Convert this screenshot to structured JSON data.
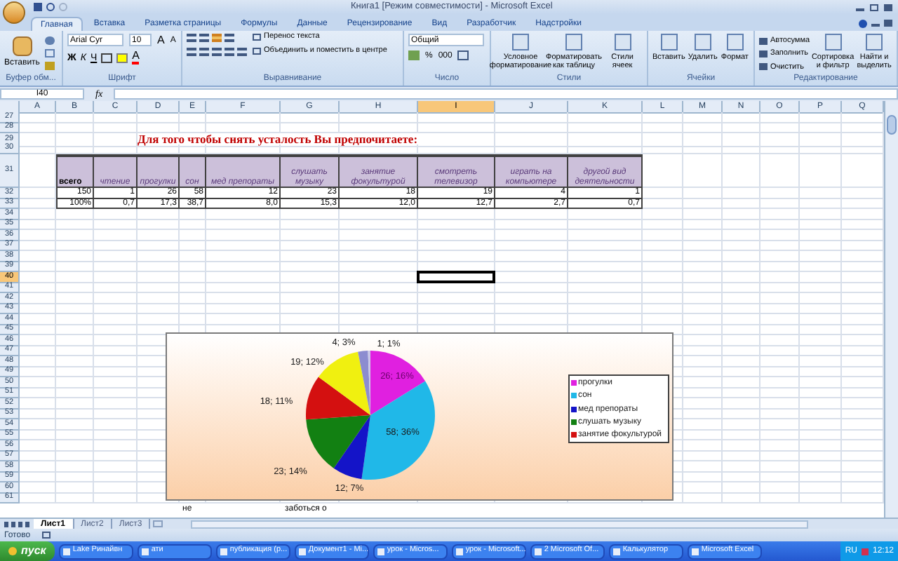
{
  "window": {
    "title": "Книга1  [Режим совместимости] - Microsoft Excel"
  },
  "tabs": [
    {
      "label": "Главная",
      "selected": true
    },
    {
      "label": "Вставка",
      "selected": false
    },
    {
      "label": "Разметка страницы",
      "selected": false
    },
    {
      "label": "Формулы",
      "selected": false
    },
    {
      "label": "Данные",
      "selected": false
    },
    {
      "label": "Рецензирование",
      "selected": false
    },
    {
      "label": "Вид",
      "selected": false
    },
    {
      "label": "Разработчик",
      "selected": false
    },
    {
      "label": "Надстройки",
      "selected": false
    }
  ],
  "ribbon": {
    "groups": [
      {
        "kind": "clipboard",
        "label": "Буфер обм...",
        "buttons": [
          "Вставить"
        ]
      },
      {
        "kind": "font",
        "label": "Шрифт",
        "font": "Arial Cyr",
        "size": "10",
        "size_buttons": [
          "A",
          "A"
        ],
        "style_buttons": [
          "Ж",
          "К",
          "Ч"
        ],
        "color_button": "A"
      },
      {
        "kind": "align",
        "label": "Выравнивание",
        "buttons": [
          "Перенос текста",
          "Объединить и поместить в центре"
        ]
      },
      {
        "kind": "number",
        "label": "Число",
        "format": "Общий",
        "buttons": [
          "%",
          "000"
        ]
      },
      {
        "kind": "large",
        "label": "Стили",
        "buttons": [
          "Условное форматирование",
          "Форматировать как таблицу",
          "Стили ячеек"
        ]
      },
      {
        "kind": "large",
        "label": "Ячейки",
        "buttons": [
          "Вставить",
          "Удалить",
          "Формат"
        ]
      },
      {
        "kind": "edit",
        "label": "Редактирование",
        "small": [
          "Автосумма",
          "Заполнить",
          "Очистить"
        ],
        "buttons": [
          "Сортировка и фильтр",
          "Найти и выделить"
        ]
      }
    ]
  },
  "formula_bar": {
    "name_box": "I40",
    "function_label": "fx"
  },
  "columns": [
    {
      "label": "A",
      "selected": false
    },
    {
      "label": "B",
      "selected": false
    },
    {
      "label": "C",
      "selected": false
    },
    {
      "label": "D",
      "selected": false
    },
    {
      "label": "E",
      "selected": false
    },
    {
      "label": "F",
      "selected": false
    },
    {
      "label": "G",
      "selected": false
    },
    {
      "label": "H",
      "selected": false
    },
    {
      "label": "I",
      "selected": true
    },
    {
      "label": "J",
      "selected": false
    },
    {
      "label": "K",
      "selected": false
    },
    {
      "label": "L",
      "selected": false
    },
    {
      "label": "M",
      "selected": false
    },
    {
      "label": "N",
      "selected": false
    },
    {
      "label": "O",
      "selected": false
    },
    {
      "label": "P",
      "selected": false
    },
    {
      "label": "Q",
      "selected": false
    }
  ],
  "rows": [
    {
      "number": "27",
      "selected": false
    },
    {
      "number": "28",
      "selected": false
    },
    {
      "number": "29",
      "selected": false,
      "kind": "title",
      "title": "Для того чтобы снять усталость Вы предпочитаете:"
    },
    {
      "number": "30",
      "selected": false
    },
    {
      "number": "31",
      "selected": false,
      "kind": "header",
      "cells": [
        "всего",
        "чтение",
        "прогулки",
        "сон",
        "мед препораты",
        "слушать музыку",
        "занятие фокультурой",
        "смотреть телевизор",
        "играть на компьютере",
        "другой вид деятельности"
      ]
    },
    {
      "number": "32",
      "selected": false,
      "kind": "data",
      "cells": [
        "150",
        "1",
        "26",
        "58",
        "12",
        "23",
        "18",
        "19",
        "4",
        "1"
      ]
    },
    {
      "number": "33",
      "selected": false,
      "kind": "data",
      "cells": [
        "100%",
        "0,7",
        "17,3",
        "38,7",
        "8,0",
        "15,3",
        "12,0",
        "12,7",
        "2,7",
        "0,7"
      ]
    },
    {
      "number": "34",
      "selected": false
    },
    {
      "number": "35",
      "selected": false
    },
    {
      "number": "36",
      "selected": false
    },
    {
      "number": "37",
      "selected": false
    },
    {
      "number": "38",
      "selected": false
    },
    {
      "number": "39",
      "selected": false
    },
    {
      "number": "40",
      "selected": true
    },
    {
      "number": "41",
      "selected": false
    },
    {
      "number": "42",
      "selected": false
    },
    {
      "number": "43",
      "selected": false
    },
    {
      "number": "44",
      "selected": false
    },
    {
      "number": "45",
      "selected": false
    },
    {
      "number": "46",
      "selected": false
    },
    {
      "number": "47",
      "selected": false
    },
    {
      "number": "48",
      "selected": false
    },
    {
      "number": "49",
      "selected": false
    },
    {
      "number": "50",
      "selected": false
    },
    {
      "number": "51",
      "selected": false
    },
    {
      "number": "52",
      "selected": false
    },
    {
      "number": "53",
      "selected": false
    },
    {
      "number": "54",
      "selected": false
    },
    {
      "number": "55",
      "selected": false
    },
    {
      "number": "56",
      "selected": false
    },
    {
      "number": "57",
      "selected": false
    },
    {
      "number": "58",
      "selected": false
    },
    {
      "number": "59",
      "selected": false
    },
    {
      "number": "60",
      "selected": false
    },
    {
      "number": "61",
      "selected": false
    }
  ],
  "partial_row": [
    "не",
    "заботься о"
  ],
  "chart": {
    "chart_data": {
      "type": "pie",
      "values": [
        26,
        58,
        12,
        23,
        18,
        19,
        4,
        1
      ],
      "colors": [
        "#e020e0",
        "#20b8e8",
        "#1414c8",
        "#128012",
        "#d41010",
        "#f0f010",
        "#8c8cd0",
        "#c8c8e8"
      ],
      "value_labels": [
        "26; 16%",
        "58; 36%",
        "12; 7%",
        "23; 14%",
        "18; 11%",
        "19; 12%",
        "4; 3%",
        "1; 1%"
      ]
    },
    "legend": [
      {
        "label": "прогулки",
        "color": "#e020e0"
      },
      {
        "label": "сон",
        "color": "#20b8e8"
      },
      {
        "label": "мед препораты",
        "color": "#1414c8"
      },
      {
        "label": "слушать музыку",
        "color": "#128012"
      },
      {
        "label": "занятие фокультурой",
        "color": "#d41010"
      }
    ]
  },
  "sheet_tabs": [
    {
      "label": "Лист1",
      "selected": true
    },
    {
      "label": "Лист2",
      "selected": false
    },
    {
      "label": "Лист3",
      "selected": false
    }
  ],
  "status_bar": {
    "text": "Готово"
  },
  "taskbar": {
    "start": "пуск",
    "items": [
      "Lake Ринайвн",
      "ати",
      "публикация (р...",
      "Документ1 - Mi...",
      "урок - Micros...",
      "урок - Microsoft...",
      "2 Microsoft Of...",
      "Калькулятор",
      "Microsoft Excel"
    ],
    "language": "RU",
    "time": "12:12"
  }
}
